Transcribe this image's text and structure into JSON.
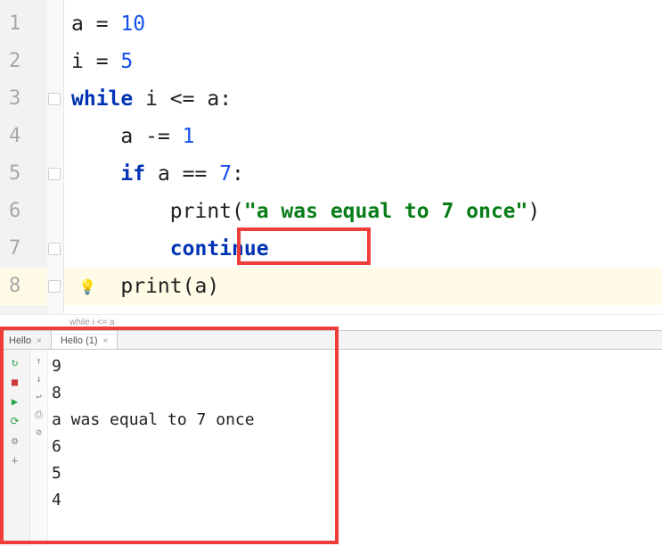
{
  "editor": {
    "lines": [
      {
        "n": "1",
        "segments": [
          {
            "cls": "",
            "t": "a "
          },
          {
            "cls": "op",
            "t": "= "
          },
          {
            "cls": "num",
            "t": "10"
          }
        ]
      },
      {
        "n": "2",
        "segments": [
          {
            "cls": "",
            "t": "i "
          },
          {
            "cls": "op",
            "t": "= "
          },
          {
            "cls": "num",
            "t": "5"
          }
        ]
      },
      {
        "n": "3",
        "segments": [
          {
            "cls": "kw",
            "t": "while"
          },
          {
            "cls": "",
            "t": " i "
          },
          {
            "cls": "op",
            "t": "<= "
          },
          {
            "cls": "",
            "t": "a:"
          }
        ]
      },
      {
        "n": "4",
        "segments": [
          {
            "cls": "",
            "t": "    a "
          },
          {
            "cls": "op",
            "t": "-= "
          },
          {
            "cls": "num",
            "t": "1"
          }
        ]
      },
      {
        "n": "5",
        "segments": [
          {
            "cls": "",
            "t": "    "
          },
          {
            "cls": "kw",
            "t": "if"
          },
          {
            "cls": "",
            "t": " a "
          },
          {
            "cls": "op",
            "t": "== "
          },
          {
            "cls": "num",
            "t": "7"
          },
          {
            "cls": "",
            "t": ":"
          }
        ]
      },
      {
        "n": "6",
        "segments": [
          {
            "cls": "",
            "t": "        "
          },
          {
            "cls": "fn",
            "t": "print"
          },
          {
            "cls": "",
            "t": "("
          },
          {
            "cls": "str",
            "t": "\"a was equal to 7 once\""
          },
          {
            "cls": "",
            "t": ")"
          }
        ]
      },
      {
        "n": "7",
        "segments": [
          {
            "cls": "",
            "t": "        "
          },
          {
            "cls": "kw",
            "t": "continue"
          }
        ]
      },
      {
        "n": "8",
        "highlight": true,
        "segments": [
          {
            "cls": "",
            "t": "    "
          },
          {
            "cls": "fn",
            "t": "print"
          },
          {
            "cls": "",
            "t": "(a)"
          }
        ]
      }
    ],
    "fold_marks_at": [
      3,
      5,
      7,
      8
    ],
    "bulb_at": 8
  },
  "breadcrumb": "while i <= a",
  "tabs": [
    {
      "label": "Hello",
      "active": false,
      "closable": true
    },
    {
      "label": "Hello (1)",
      "active": true,
      "closable": true
    }
  ],
  "run_gutter": {
    "buttons": [
      {
        "name": "rerun",
        "glyph": "↻",
        "color": "#2aa34a"
      },
      {
        "name": "stop",
        "glyph": "■",
        "color": "#cc3b3b"
      },
      {
        "name": "resume",
        "glyph": "▶",
        "color": "#2aa34a"
      },
      {
        "name": "debug-restart",
        "glyph": "⟳",
        "color": "#2aa34a"
      },
      {
        "name": "settings",
        "glyph": "⚙",
        "color": "#888"
      },
      {
        "name": "add",
        "glyph": "+",
        "color": "#888"
      }
    ],
    "sub": [
      {
        "name": "up",
        "glyph": "↑"
      },
      {
        "name": "down",
        "glyph": "↓"
      },
      {
        "name": "soft-wrap",
        "glyph": "↩"
      },
      {
        "name": "print",
        "glyph": "⎙"
      },
      {
        "name": "clear",
        "glyph": "⊘"
      }
    ]
  },
  "console_output": "9\n8\na was equal to 7 once\n6\n5\n4"
}
